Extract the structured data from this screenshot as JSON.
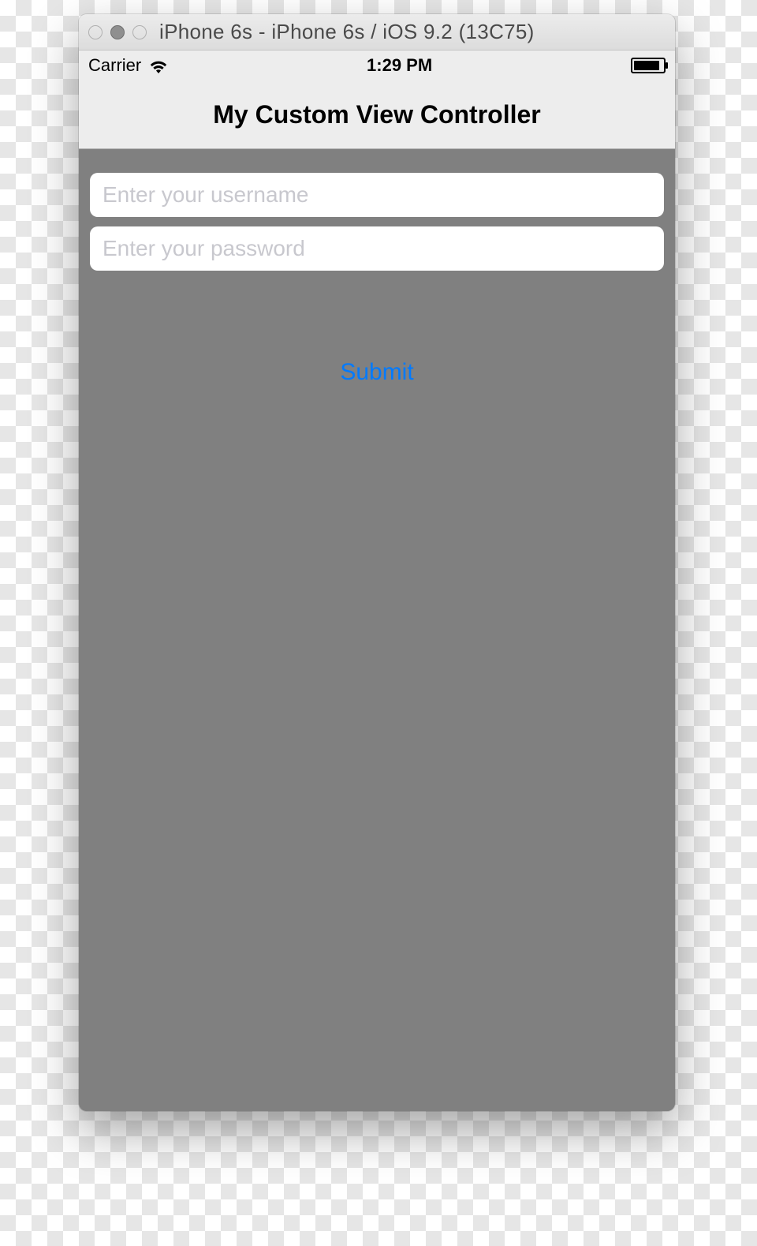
{
  "window": {
    "title": "iPhone 6s - iPhone 6s / iOS 9.2 (13C75)"
  },
  "statusbar": {
    "carrier": "Carrier",
    "time": "1:29 PM"
  },
  "navbar": {
    "title": "My Custom View Controller"
  },
  "form": {
    "username_placeholder": "Enter your username",
    "password_placeholder": "Enter your password",
    "submit_label": "Submit"
  }
}
